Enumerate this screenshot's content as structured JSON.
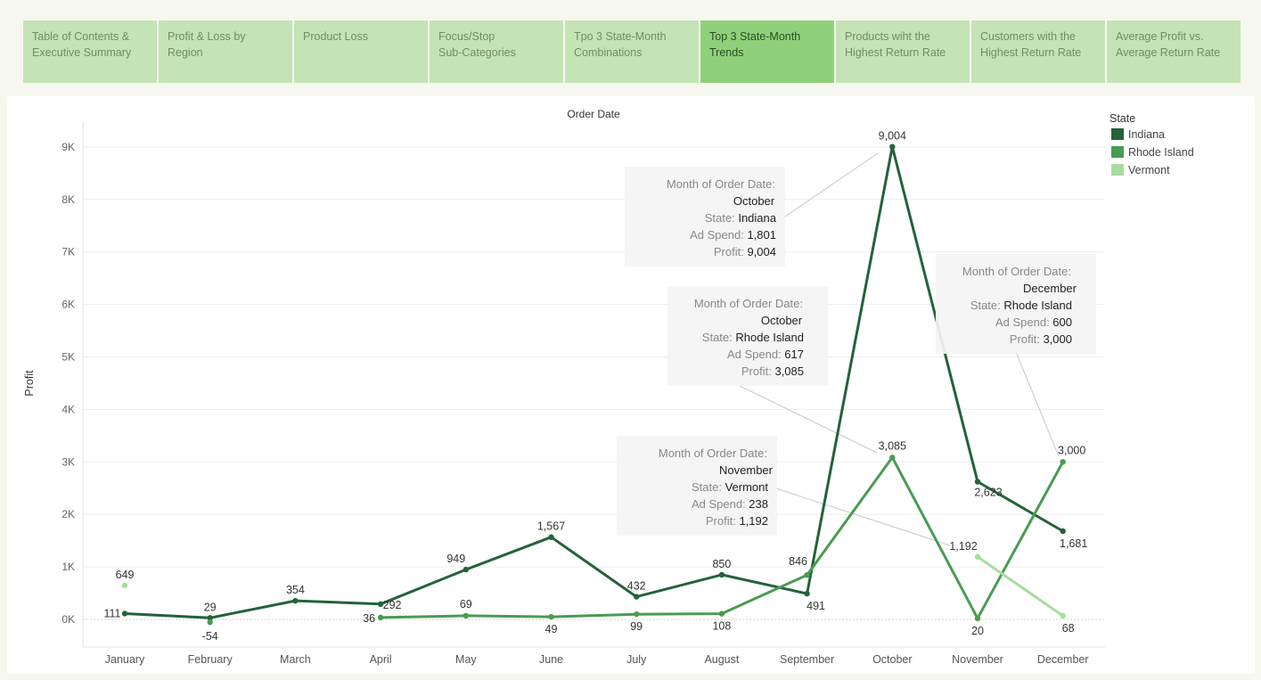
{
  "tabs": [
    {
      "label": "Table of Contents &\nExecutive Summary",
      "active": false
    },
    {
      "label": "Profit & Loss by Region",
      "active": false
    },
    {
      "label": "Product Loss",
      "active": false
    },
    {
      "label": "Focus/Stop\nSub-Categories",
      "active": false
    },
    {
      "label": "Tpo 3 State-Month\nCombinations",
      "active": false
    },
    {
      "label": "Top 3 State-Month\nTrends",
      "active": true
    },
    {
      "label": "Products wiht the\nHighest Return Rate",
      "active": false
    },
    {
      "label": "Customers with the\nHighest Return Rate",
      "active": false
    },
    {
      "label": "Average Profit vs.\nAverage Return Rate",
      "active": false
    }
  ],
  "chart_data": {
    "type": "line",
    "title": "Order Date",
    "xlabel": "Order Date",
    "ylabel": "Profit",
    "categories": [
      "January",
      "February",
      "March",
      "April",
      "May",
      "June",
      "July",
      "August",
      "September",
      "October",
      "November",
      "December"
    ],
    "yticks": [
      "0K",
      "1K",
      "2K",
      "3K",
      "4K",
      "5K",
      "6K",
      "7K",
      "8K",
      "9K"
    ],
    "ylim": [
      -500,
      9500
    ],
    "legend_title": "State",
    "legend_position": "top-right",
    "grid": true,
    "series": [
      {
        "name": "Indiana",
        "color": "#24623a",
        "values": [
          111,
          29,
          354,
          292,
          949,
          1567,
          432,
          850,
          491,
          9004,
          2623,
          1681
        ],
        "labels": [
          "111",
          "29",
          "354",
          "292",
          "949",
          "1,567",
          "432",
          "850",
          "491",
          "9,004",
          "2,623",
          "1,681"
        ]
      },
      {
        "name": "Rhode Island",
        "color": "#4a9b52",
        "values": [
          null,
          -54,
          null,
          36,
          69,
          49,
          99,
          108,
          846,
          3085,
          20,
          3000
        ],
        "labels": [
          null,
          "-54",
          null,
          "36",
          "69",
          "49",
          "99",
          "108",
          "846",
          "3,085",
          "20",
          "3,000"
        ]
      },
      {
        "name": "Vermont",
        "color": "#a8dca0",
        "values": [
          649,
          null,
          null,
          null,
          null,
          null,
          null,
          null,
          null,
          null,
          1192,
          68
        ],
        "labels": [
          "649",
          null,
          null,
          null,
          null,
          null,
          null,
          null,
          null,
          null,
          "1,192",
          "68"
        ]
      }
    ],
    "tooltips": [
      {
        "rows": [
          [
            "Month of Order Date:",
            ""
          ],
          [
            "",
            "October"
          ],
          [
            "State:",
            "Indiana"
          ],
          [
            "Ad Spend:",
            "1,801"
          ],
          [
            "Profit:",
            "9,004"
          ]
        ],
        "series": 0,
        "month": 9
      },
      {
        "rows": [
          [
            "Month of Order Date:",
            ""
          ],
          [
            "",
            "October"
          ],
          [
            "State:",
            "Rhode Island"
          ],
          [
            "Ad Spend:",
            "617"
          ],
          [
            "Profit:",
            "3,085"
          ]
        ],
        "series": 1,
        "month": 9
      },
      {
        "rows": [
          [
            "Month of Order Date:",
            ""
          ],
          [
            "",
            "November"
          ],
          [
            "State:",
            "Vermont"
          ],
          [
            "Ad Spend:",
            "238"
          ],
          [
            "Profit:",
            "1,192"
          ]
        ],
        "series": 2,
        "month": 10
      },
      {
        "rows": [
          [
            "Month of Order Date:",
            ""
          ],
          [
            "",
            "December"
          ],
          [
            "State:",
            "Rhode Island"
          ],
          [
            "Ad Spend:",
            "600"
          ],
          [
            "Profit:",
            "3,000"
          ]
        ],
        "series": 1,
        "month": 11
      }
    ]
  }
}
